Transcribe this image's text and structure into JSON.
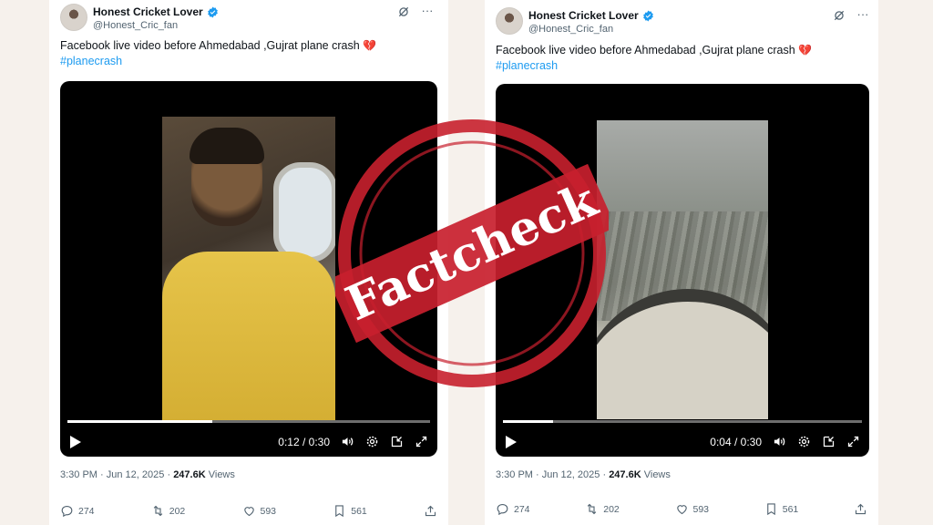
{
  "tweets": [
    {
      "name": "Honest Cricket Lover",
      "handle": "@Honest_Cric_fan",
      "text": "Facebook live video before Ahmedabad ,Gujrat   plane crash",
      "emoji": "💔",
      "hashtag": "#planecrash",
      "video": {
        "time": "0:12 / 0:30",
        "progress": 0.4
      },
      "meta": {
        "time": "3:30 PM",
        "date": "Jun 12, 2025",
        "views_count": "247.6K",
        "views_label": "Views",
        "sep": "·"
      },
      "actions": {
        "replies": "274",
        "reposts": "202",
        "likes": "593",
        "bookmarks": "561"
      }
    },
    {
      "name": "Honest Cricket Lover",
      "handle": "@Honest_Cric_fan",
      "text": "Facebook live video before Ahmedabad ,Gujrat   plane crash",
      "emoji": "💔",
      "hashtag": "#planecrash",
      "video": {
        "time": "0:04 / 0:30",
        "progress": 0.14
      },
      "meta": {
        "time": "3:30 PM",
        "date": "Jun 12, 2025",
        "views_count": "247.6K",
        "views_label": "Views",
        "sep": "·"
      },
      "actions": {
        "replies": "274",
        "reposts": "202",
        "likes": "593",
        "bookmarks": "561"
      }
    }
  ],
  "stamp": {
    "text": "Factcheck",
    "color": "#c8202e"
  },
  "colors": {
    "link": "#1d9bf0",
    "verified": "#1d9bf0",
    "muted": "#536471",
    "background": "#f6f1ec"
  }
}
